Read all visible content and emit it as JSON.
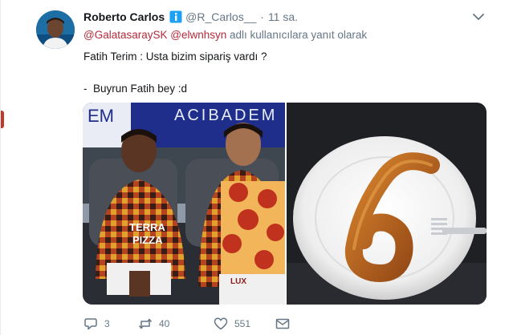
{
  "tweet": {
    "author_name": "Roberto Carlos",
    "author_handle": "@R_Carlos__",
    "separator": "·",
    "time": "11 sa.",
    "reply_mentions": [
      "@GalatasaraySK",
      "@elwnhsyn"
    ],
    "reply_suffix": "adlı kullanıcılara yanıt olarak",
    "text": "Fatih Terim : Usta bizim sipariş vardı ?\n\n-  Buyrun Fatih bey :d",
    "media_banner_left": "EM",
    "media_banner_right": "ACIBADEM",
    "jersey_text_line1": "TERRA",
    "jersey_text_line2": "PIZZA",
    "jersey_text_bottom": "LUX"
  },
  "actions": {
    "reply_count": "3",
    "retweet_count": "40",
    "like_count": "551"
  },
  "colors": {
    "name": "#14171a",
    "secondary": "#657786",
    "mention": "#b22b3b",
    "verified": "#1da1f2",
    "background": "#e6ecf0"
  },
  "icons": [
    "verified-badge-icon",
    "chevron-down-icon",
    "reply-icon",
    "retweet-icon",
    "heart-icon",
    "envelope-icon"
  ]
}
